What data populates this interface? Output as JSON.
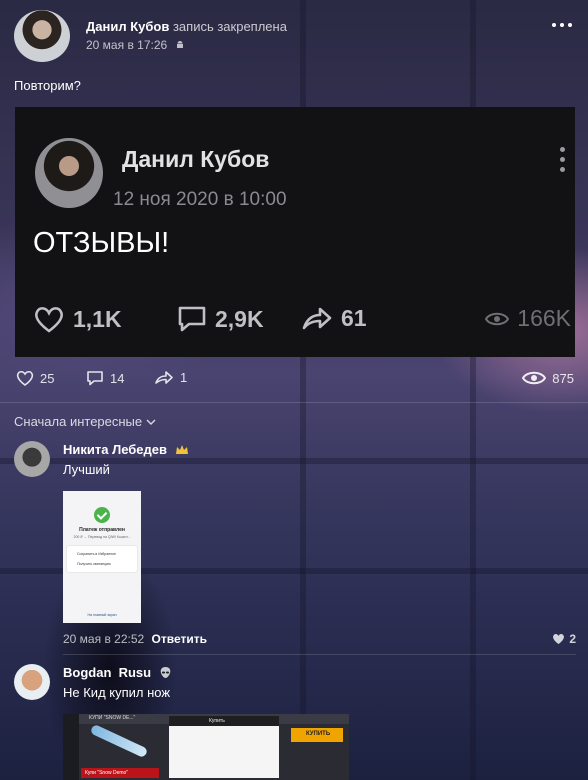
{
  "post": {
    "author": "Данил Кубов",
    "action": "запись закреплена",
    "date": "20 мая в 17:26",
    "text": "Повторим?",
    "icons": {
      "platform": "android-icon",
      "more": "more-dots-icon"
    },
    "embed": {
      "author": "Данил Кубов",
      "date": "12 ноя 2020 в 10:00",
      "text": "ОТЗЫВЫ!",
      "likes": "1,1K",
      "comments": "2,9K",
      "shares": "61",
      "views": "166K"
    },
    "stats": {
      "likes": "25",
      "comments": "14",
      "shares": "1",
      "views": "875"
    }
  },
  "comments_sort": "Сначала интересные",
  "comments": [
    {
      "author": "Никита Лебедев",
      "badge": "crown-icon",
      "text": "Лучший",
      "attachment": {
        "title": "Платеж отправлен",
        "subtitle": "200 ₽ → Перевод на QIWI Кошел...",
        "item1": "Сохранить в Избранное",
        "item2": "Получить квитанцию",
        "footer": "На главный экран"
      },
      "date": "20 мая в 22:52",
      "reply": "Ответить",
      "likes": "2"
    },
    {
      "author": "Bogdan  Rusu",
      "badge": "alien-icon",
      "text": "Не Кид купил нож",
      "attachment": {
        "header": "КУПИ \"SNOW DE...\"",
        "dialog_title": "Купить",
        "button": "КУПИТЬ",
        "red_label": "Купи \"Snow Demo\""
      }
    }
  ],
  "colors": {
    "embed_bg": "#121214",
    "accent_like": "#e2e2e4",
    "red": "#b8141a",
    "orange": "#f0a400"
  }
}
